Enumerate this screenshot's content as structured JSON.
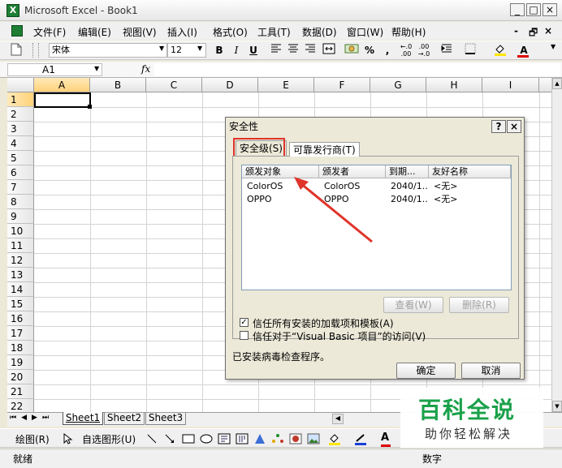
{
  "window": {
    "title": "Microsoft Excel - Book1",
    "min": "_",
    "max": "□",
    "close": "×"
  },
  "menu": {
    "items": [
      "文件(F)",
      "编辑(E)",
      "视图(V)",
      "插入(I)",
      "格式(O)",
      "工具(T)",
      "数据(D)",
      "窗口(W)",
      "帮助(H)"
    ],
    "doc_min": "-",
    "doc_restore": "🗗",
    "doc_close": "×"
  },
  "toolbar": {
    "font_name": "宋体",
    "font_size": "12",
    "bold": "B",
    "italic": "I",
    "underline": "U",
    "percent": "%",
    "comma": ",",
    "inc_dec": "+.0 .00",
    "dec_dec": ".00 +.0"
  },
  "formula_bar": {
    "name_box": "A1",
    "fx": "fx",
    "formula": ""
  },
  "sheet": {
    "columns": [
      "A",
      "B",
      "C",
      "D",
      "E",
      "F",
      "G",
      "H",
      "I"
    ],
    "rows": [
      "1",
      "2",
      "3",
      "4",
      "5",
      "6",
      "7",
      "8",
      "9",
      "10",
      "11",
      "12",
      "13",
      "14",
      "15",
      "16",
      "17",
      "18",
      "19",
      "20",
      "21",
      "22"
    ],
    "active_cell": "A1"
  },
  "sheet_tabs": [
    "Sheet1",
    "Sheet2",
    "Sheet3"
  ],
  "drawing_toolbar": {
    "draw": "绘图(R)",
    "autoshapes": "自选图形(U)"
  },
  "status": {
    "left": "就绪",
    "right": "数字"
  },
  "dialog": {
    "title": "安全性",
    "help": "?",
    "close": "×",
    "tabs": [
      "安全级(S)",
      "可靠发行商(T)"
    ],
    "list_headers": [
      "颁发对象",
      "颁发者",
      "到期...",
      "友好名称"
    ],
    "list_rows": [
      [
        "ColorOS",
        "ColorOS",
        "2040/1...",
        "<无>"
      ],
      [
        "OPPO",
        "OPPO",
        "2040/1...",
        "<无>"
      ]
    ],
    "view_button": "查看(W)",
    "remove_button": "删除(R)",
    "checkbox1": {
      "label": "信任所有安装的加载项和模板(A)",
      "checked": true
    },
    "checkbox2": {
      "label": "信任对于“Visual Basic 项目”的访问(V)",
      "checked": false
    },
    "antivirus_text": "已安装病毒检查程序。",
    "ok": "确定",
    "cancel": "取消"
  },
  "watermark": {
    "brand": "百科全说",
    "tagline": "助你轻松解决"
  },
  "colors": {
    "highlight_red": "#e0342a",
    "watermark_green": "#1aa14a"
  }
}
